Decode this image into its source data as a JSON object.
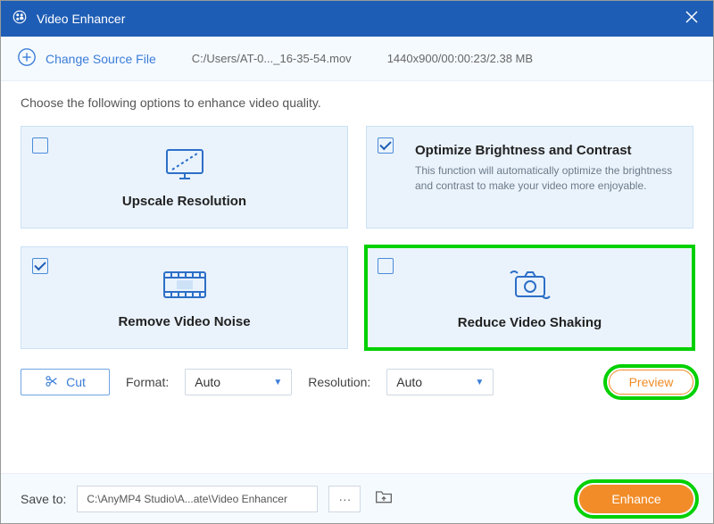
{
  "titlebar": {
    "title": "Video Enhancer"
  },
  "toolbar": {
    "change_source": "Change Source File",
    "file_path": "C:/Users/AT-0..._16-35-54.mov",
    "file_meta": "1440x900/00:00:23/2.38 MB"
  },
  "content": {
    "instruction": "Choose the following options to enhance video quality.",
    "cards": [
      {
        "title": "Upscale Resolution",
        "checked": false
      },
      {
        "title": "Optimize Brightness and Contrast",
        "desc": "This function will automatically optimize the brightness and contrast to make your video more enjoyable.",
        "checked": true
      },
      {
        "title": "Remove Video Noise",
        "checked": true
      },
      {
        "title": "Reduce Video Shaking",
        "checked": false
      }
    ]
  },
  "controls": {
    "cut": "Cut",
    "format_label": "Format:",
    "format_value": "Auto",
    "resolution_label": "Resolution:",
    "resolution_value": "Auto",
    "preview": "Preview"
  },
  "footer": {
    "save_to_label": "Save to:",
    "save_path": "C:\\AnyMP4 Studio\\A...ate\\Video Enhancer",
    "dots": "···",
    "enhance": "Enhance"
  }
}
